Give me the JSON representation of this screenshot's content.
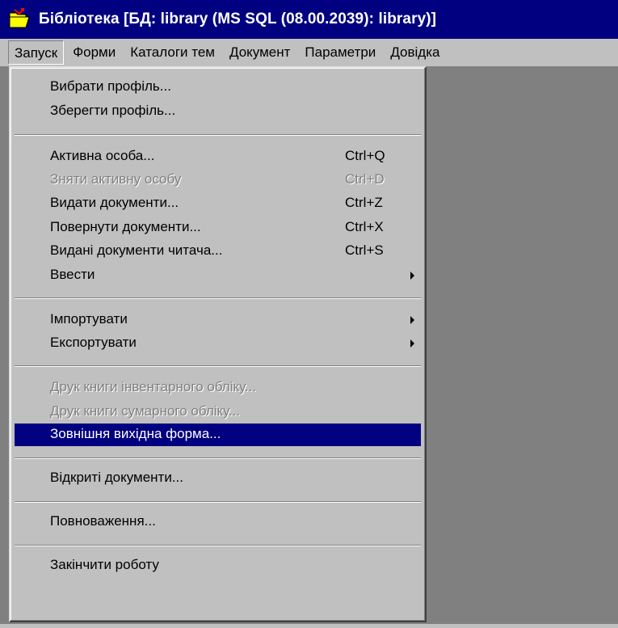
{
  "window": {
    "title": "Бібліотека [БД: library (MS SQL (08.00.2039): library)]",
    "icon": "folder-open-icon"
  },
  "menubar": [
    {
      "label": "Запуск",
      "open": true
    },
    {
      "label": "Форми"
    },
    {
      "label": "Каталоги тем"
    },
    {
      "label": "Документ"
    },
    {
      "label": "Параметри"
    },
    {
      "label": "Довідка"
    }
  ],
  "dropdown": {
    "items": [
      {
        "label": "Вибрати профіль...",
        "enabled": true
      },
      {
        "label": "Зберегти профіль...",
        "enabled": true
      },
      {
        "label": "Активна особа...",
        "shortcut": "Ctrl+Q",
        "enabled": true
      },
      {
        "label": "Зняти активну особу",
        "shortcut": "Ctrl+D",
        "enabled": false
      },
      {
        "label": "Видати документи...",
        "shortcut": "Ctrl+Z",
        "enabled": true
      },
      {
        "label": "Повернути документи...",
        "shortcut": "Ctrl+X",
        "enabled": true
      },
      {
        "label": "Видані документи читача...",
        "shortcut": "Ctrl+S",
        "enabled": true
      },
      {
        "label": "Ввести",
        "submenu": true,
        "enabled": true
      },
      {
        "label": "Імпортувати",
        "submenu": true,
        "enabled": true
      },
      {
        "label": "Експортувати",
        "submenu": true,
        "enabled": true
      },
      {
        "label": "Друк книги інвентарного обліку...",
        "enabled": false
      },
      {
        "label": "Друк книги сумарного обліку...",
        "enabled": false
      },
      {
        "label": "Зовнішня вихідна форма...",
        "enabled": true,
        "selected": true
      },
      {
        "label": "Відкриті документи...",
        "enabled": true
      },
      {
        "label": "Повноваження...",
        "enabled": true
      },
      {
        "label": "Закінчити роботу",
        "enabled": true
      }
    ]
  },
  "colors": {
    "title_bar": "#000080",
    "menu_face": "#c0c0c0",
    "client_area": "#808080",
    "selection": "#000080",
    "disabled_text": "#808080"
  }
}
